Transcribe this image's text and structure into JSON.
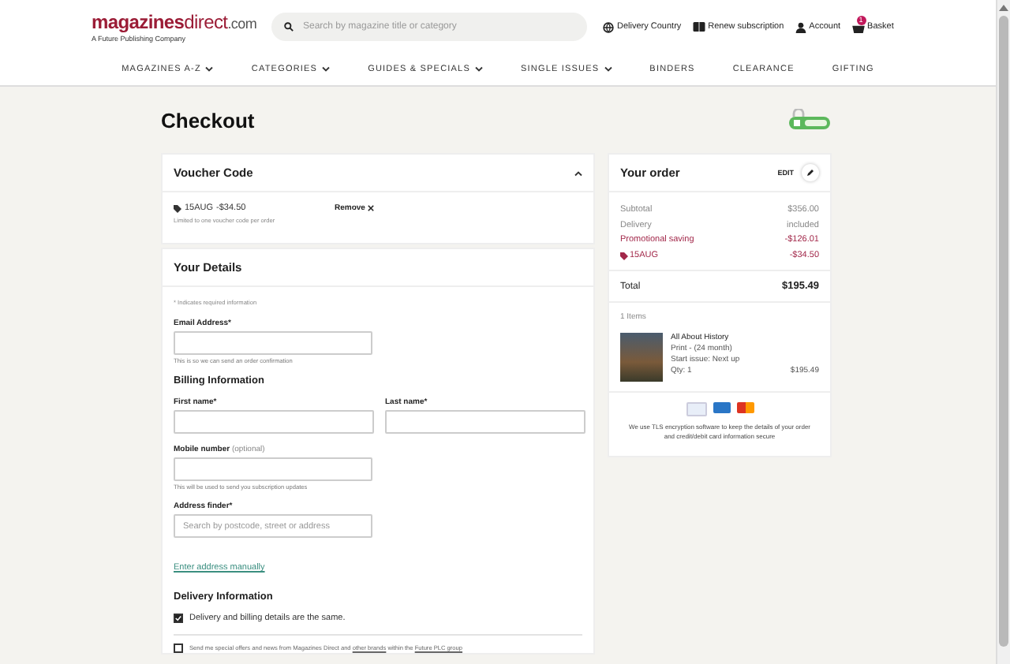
{
  "header": {
    "logo": {
      "parts": [
        {
          "kind": "strong",
          "text": "magazines"
        },
        {
          "kind": "light",
          "text": "direct"
        },
        {
          "kind": "suffix",
          "text": ".com"
        }
      ],
      "tagline": "A Future Publishing Company"
    },
    "search": {
      "placeholder": "Search by magazine title or category"
    },
    "links": [
      {
        "label": "Delivery Country"
      },
      {
        "label": "Renew subscription"
      },
      {
        "label": "Account"
      },
      {
        "label": "Basket",
        "badge": "1"
      }
    ]
  },
  "nav": [
    {
      "label": "MAGAZINES A-Z",
      "dropdown": true
    },
    {
      "label": "CATEGORIES",
      "dropdown": true
    },
    {
      "label": "GUIDES & SPECIALS",
      "dropdown": true
    },
    {
      "label": "SINGLE ISSUES",
      "dropdown": true
    },
    {
      "label": "BINDERS",
      "dropdown": false
    },
    {
      "label": "CLEARANCE",
      "dropdown": false
    },
    {
      "label": "GIFTING",
      "dropdown": false
    }
  ],
  "title": "Checkout",
  "voucher": {
    "title": "Voucher Code",
    "expanded": true,
    "code": "15AUG",
    "amount": "-$34.50",
    "note": "Limited to one voucher code per order",
    "remove": "Remove"
  },
  "details": {
    "title": "Your Details",
    "required_note": "* Indicates required information",
    "rows": [
      {
        "kind": "field",
        "label": "Email Address*",
        "hint": "This is so we can send an order confirmation"
      },
      {
        "kind": "heading",
        "text": "Billing Information"
      },
      {
        "kind": "pair",
        "fields": [
          {
            "label": "First name*"
          },
          {
            "label": "Last name*"
          }
        ]
      },
      {
        "kind": "field",
        "label": "Mobile number",
        "optional": "(optional)",
        "hint": "This will be used to send you subscription updates"
      },
      {
        "kind": "field",
        "label": "Address finder*",
        "placeholder": "Search by postcode, street or address"
      },
      {
        "kind": "link",
        "text": "Enter address manually"
      },
      {
        "kind": "heading",
        "text": "Delivery Information"
      },
      {
        "kind": "checkbox",
        "checked": true,
        "parts": [
          {
            "kind": "text",
            "text": "Delivery and billing details are the same."
          }
        ]
      },
      {
        "kind": "divider"
      },
      {
        "kind": "fineprint",
        "checked": false,
        "parts": [
          {
            "kind": "text",
            "text": "Send me special offers and news from Magazines Direct and "
          },
          {
            "kind": "link",
            "text": "other brands"
          },
          {
            "kind": "text",
            "text": " within the "
          },
          {
            "kind": "link",
            "text": "Future PLC group"
          }
        ]
      }
    ]
  },
  "order": {
    "title": "Your order",
    "edit": "EDIT",
    "lines": [
      {
        "kind": "plain",
        "label": "Subtotal",
        "value": "$356.00"
      },
      {
        "kind": "plain",
        "label": "Delivery",
        "value": "included"
      },
      {
        "kind": "promo",
        "label": "Promotional saving",
        "value": "-$126.01"
      },
      {
        "kind": "voucher",
        "label": "15AUG",
        "value": "-$34.50"
      }
    ],
    "total": {
      "label": "Total",
      "value": "$195.49"
    },
    "count": "1 Items",
    "item": {
      "title": "All About History",
      "lines": [
        "Print - (24 month)",
        "Start issue: Next up",
        "Qty: 1"
      ],
      "price": "$195.49"
    },
    "security": "We use TLS encryption software to keep the details of your order and credit/debit card information secure"
  }
}
